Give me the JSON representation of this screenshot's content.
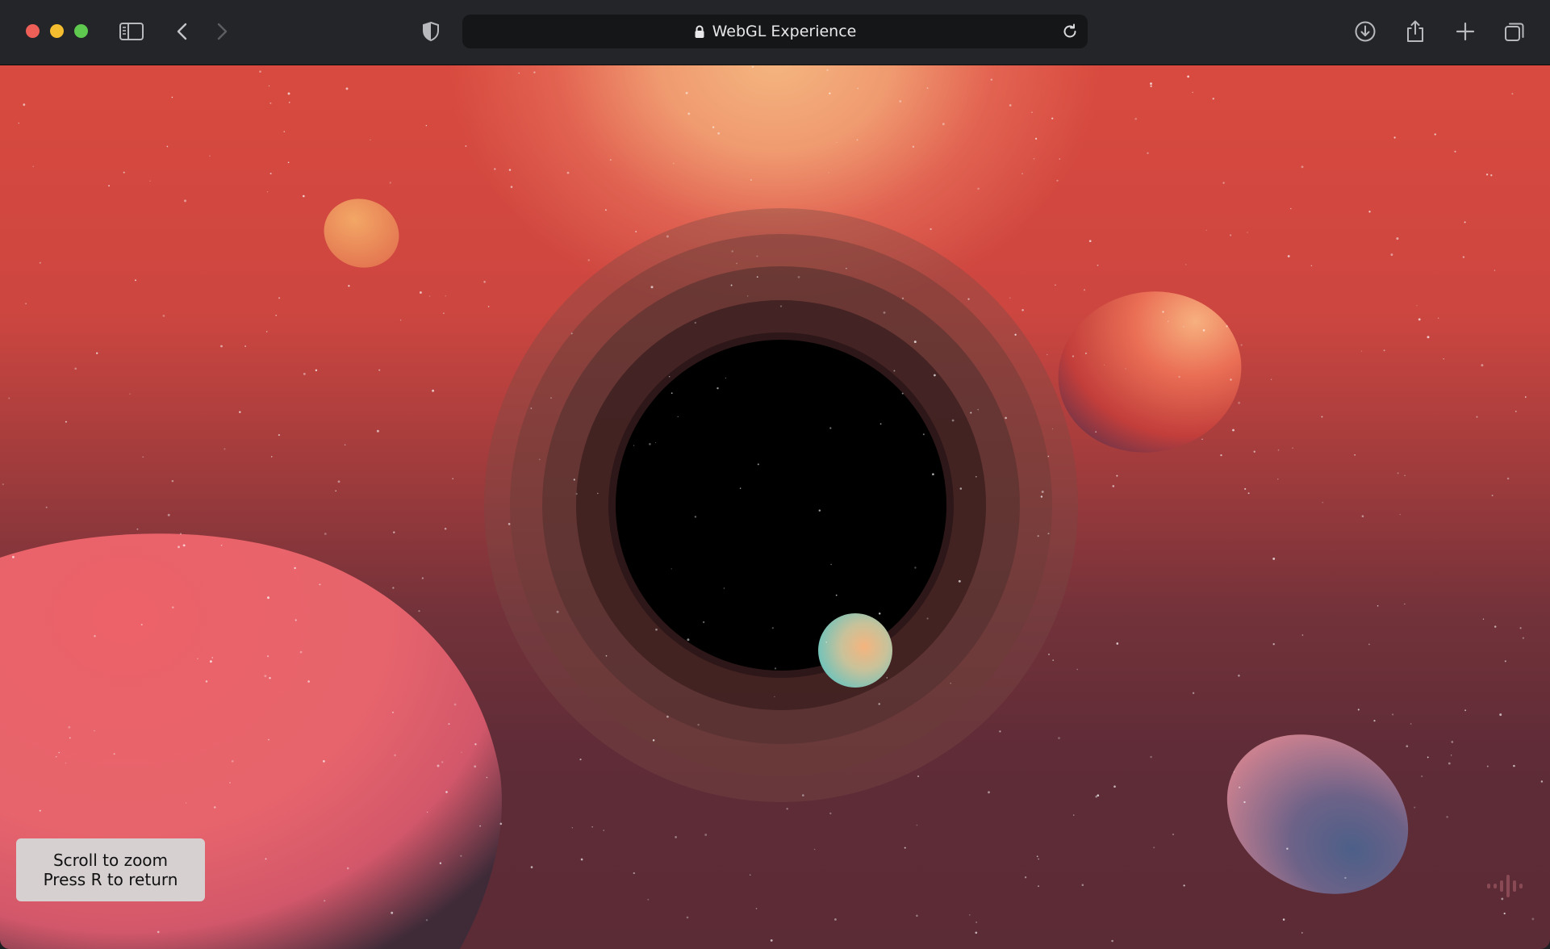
{
  "window": {
    "controls": [
      "close",
      "minimize",
      "maximize"
    ]
  },
  "toolbar": {
    "icons": {
      "sidebar": "sidebar-icon",
      "back": "chevron-left-icon",
      "forward": "chevron-right-icon",
      "privacy": "shield-icon",
      "downloads": "download-icon",
      "share": "share-icon",
      "new_tab": "plus-icon",
      "tab_overview": "tabs-icon"
    }
  },
  "address_bar": {
    "title": "WebGL Experience",
    "secure": true,
    "icons": {
      "lock": "lock-icon",
      "reload": "reload-icon"
    }
  },
  "overlay": {
    "hint_line_1": "Scroll to zoom",
    "hint_line_2": "Press R to return",
    "audio_icon": "audio-wave-icon"
  },
  "colors": {
    "toolbar_bg": "#242528",
    "address_bg": "#151618",
    "sky_top": "#f4b680",
    "sky_mid": "#cd4640",
    "sky_bottom": "#5b2b36",
    "black_hole": "#000000",
    "hint_bg": "#d6d0d1"
  }
}
